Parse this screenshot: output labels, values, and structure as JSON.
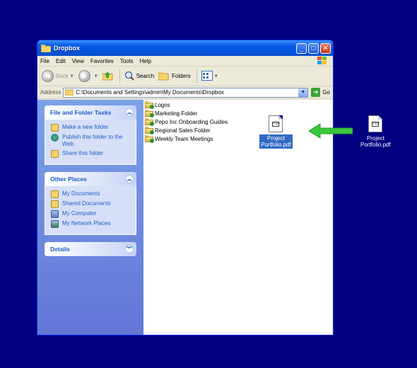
{
  "window": {
    "title": "Dropbox"
  },
  "menu": [
    "File",
    "Edit",
    "View",
    "Favorites",
    "Tools",
    "Help"
  ],
  "toolbar": {
    "back_label": "Back",
    "search_label": "Search",
    "folders_label": "Folders"
  },
  "address": {
    "label": "Address",
    "path": "C:\\Documents and Settings\\admin\\My Documents\\Dropbox",
    "go_label": "Go"
  },
  "side_panels": {
    "tasks": {
      "title": "File and Folder Tasks",
      "items": [
        "Make a new folder",
        "Publish this folder to the Web",
        "Share this folder"
      ]
    },
    "places": {
      "title": "Other Places",
      "items": [
        "My Documents",
        "Shared Documents",
        "My Computer",
        "My Network Places"
      ]
    },
    "details": {
      "title": "Details"
    }
  },
  "files": [
    "Logos",
    "Marketing Folder",
    "Pepo Inc Onboarding Guides",
    "Regional Sales Folder",
    "Weekly Team Meetings"
  ],
  "pdf_in_folder": {
    "line1": "Project",
    "line2": "Portfolio.pdf"
  },
  "pdf_on_desktop": {
    "line1": "Project",
    "line2": "Portfolio.pdf"
  },
  "colors": {
    "desktop": "#000080",
    "arrow": "#3cc83c",
    "selection": "#316ac5"
  }
}
